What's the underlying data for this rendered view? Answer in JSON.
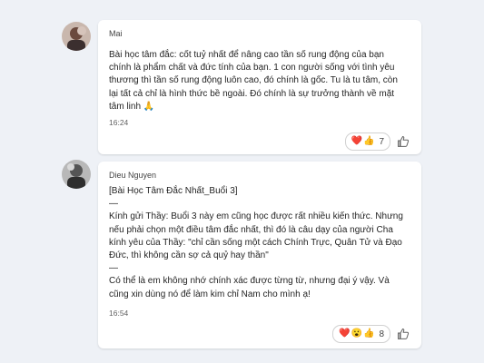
{
  "messages": [
    {
      "sender": "Mai",
      "body": [
        "Bài học tâm đắc: cốt tuỷ nhất để nâng cao tần số rung động của bạn chính là phẩm chất và đức tính của bạn. 1 con người sống với tình yêu thương thì tần số rung động luôn cao, đó chính là gốc. Tu là tu tâm, còn lại tất cả chỉ là hình thức bề ngoài. Đó chính là sự trưởng thành về mặt tâm linh 🙏"
      ],
      "time": "16:24",
      "reactions": {
        "emojis": [
          "❤️",
          "👍"
        ],
        "count": "7"
      }
    },
    {
      "sender": "Dieu Nguyen",
      "body": [
        "[Bài Học Tâm Đắc Nhất_Buổi 3]",
        "—",
        "Kính gửi Thầy: Buổi 3 này em cũng học được rất nhiều kiến thức. Nhưng nếu phải chọn một điều tâm đắc nhất, thì đó là câu dạy của người Cha kính yêu của Thầy: \"chỉ cần sống một cách Chính Trực, Quân Tử và Đạo Đức, thì không cần sợ cả quỷ hay thần\"",
        "—",
        "Có thể là em không nhớ chính xác được từng từ, nhưng đại ý vậy. Và cũng xin dùng nó để làm kim chỉ Nam cho mình ạ!"
      ],
      "time": "16:54",
      "reactions": {
        "emojis": [
          "❤️",
          "😮",
          "👍"
        ],
        "count": "8"
      }
    }
  ]
}
